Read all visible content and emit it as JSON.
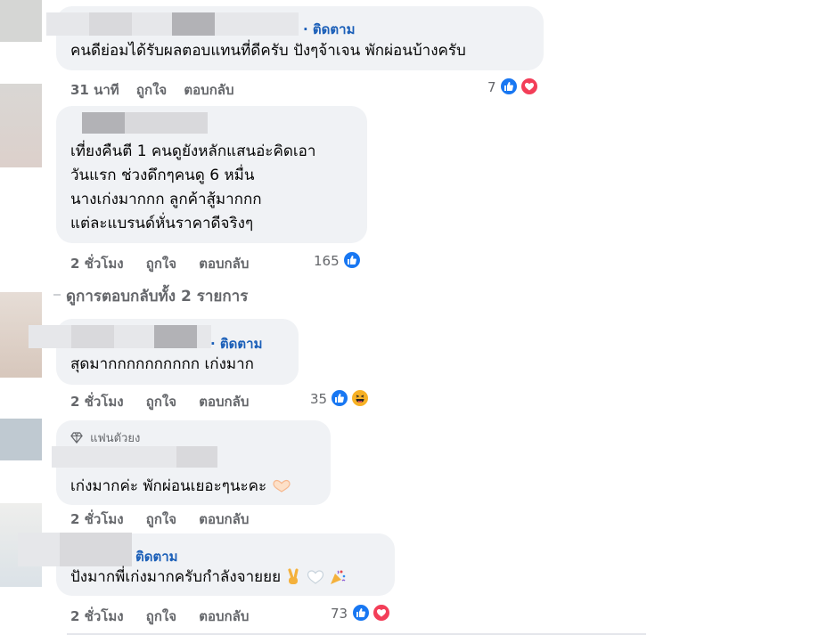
{
  "comments": [
    {
      "follow": "· ติดตาม",
      "text": "คนดีย่อมได้รับผลตอบแทนที่ดีครับ ปังๆจ้าเจน พักผ่อนบ้างครับ",
      "time": "31 นาที",
      "like_label": "ถูกใจ",
      "reply_label": "ตอบกลับ",
      "reaction_count": "7",
      "reactions": [
        "like-icon",
        "love-icon"
      ]
    },
    {
      "lines": [
        "เที่ยงคืนตี 1 คนดูยังหลักแสนอ่ะคิดเอา",
        "วันแรก ช่วงดึกๆคนดู 6 หมื่น",
        "นางเก่งมากกก ลูกค้าสู้มากกก",
        "แต่ละแบรนด์หั่นราคาดีจริงๆ"
      ],
      "time": "2 ชั่วโมง",
      "like_label": "ถูกใจ",
      "reply_label": "ตอบกลับ",
      "reaction_count": "165",
      "reactions": [
        "like-icon"
      ]
    },
    {
      "view_replies": "ดูการตอบกลับทั้ง 2 รายการ"
    },
    {
      "follow": "· ติดตาม",
      "text": "สุดมากกกกกกกกกก เก่งมาก",
      "time": "2 ชั่วโมง",
      "like_label": "ถูกใจ",
      "reply_label": "ตอบกลับ",
      "reaction_count": "35",
      "reactions": [
        "like-icon",
        "haha-icon"
      ]
    },
    {
      "badge": "แฟนตัวยง",
      "text": "เก่งมากค่ะ พักผ่อนเยอะๆนะคะ",
      "emoji": "heart-hands-emoji",
      "time": "2 ชั่วโมง",
      "like_label": "ถูกใจ",
      "reply_label": "ตอบกลับ"
    },
    {
      "follow": "ติดตาม",
      "text": "ปังมากพี่เก่งมากครับกำลังจายยย",
      "emojis": [
        "victory-hand-emoji",
        "white-heart-emoji",
        "party-popper-emoji"
      ],
      "time": "2 ชั่วโมง",
      "like_label": "ถูกใจ",
      "reply_label": "ตอบกลับ",
      "reaction_count": "73",
      "reactions": [
        "like-icon",
        "love-icon"
      ]
    }
  ],
  "colors": {
    "bubble": "#f0f2f5",
    "meta_text": "#65676b",
    "follow_link": "#1b5fb8",
    "like_blue": "#1877f2",
    "love_red": "#f33e58"
  }
}
